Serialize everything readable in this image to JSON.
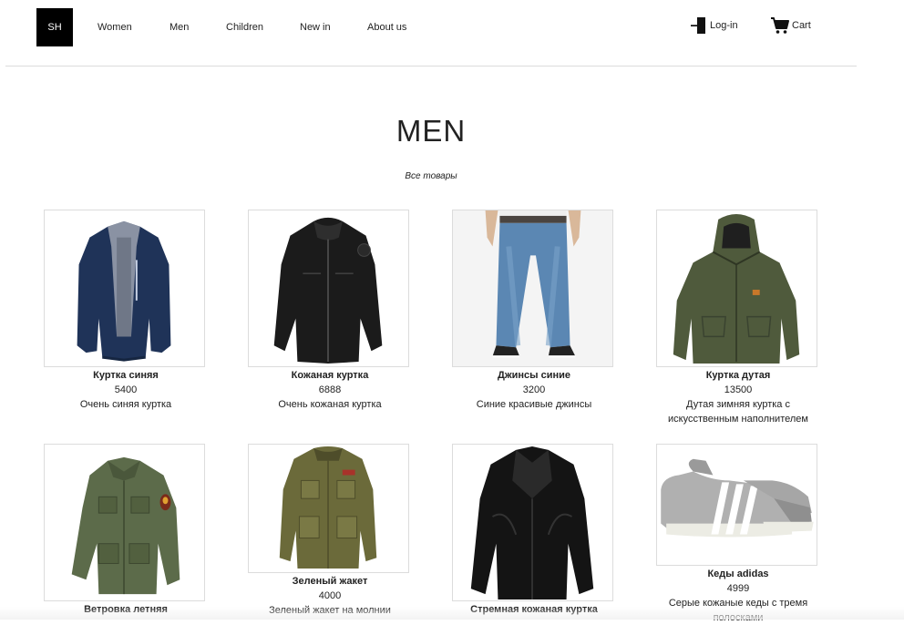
{
  "header": {
    "logo": "SH",
    "nav": [
      "Women",
      "Men",
      "Children",
      "New in",
      "About us"
    ],
    "login_label": "Log-in",
    "cart_label": "Cart"
  },
  "page": {
    "title": "MEN",
    "subtitle": "Все товары"
  },
  "products": [
    {
      "name": "Куртка синяя",
      "price": "5400",
      "description": "Очень синяя куртка",
      "icon": "blue-jacket-image"
    },
    {
      "name": "Кожаная куртка",
      "price": "6888",
      "description": "Очень кожаная куртка",
      "icon": "leather-jacket-image"
    },
    {
      "name": "Джинсы синие",
      "price": "3200",
      "description": "Синие красивые джинсы",
      "icon": "jeans-image"
    },
    {
      "name": "Куртка дутая",
      "price": "13500",
      "description": "Дутая зимняя куртка с искусственным наполнителем",
      "icon": "hooded-jacket-image"
    },
    {
      "name": "Ветровка летняя",
      "price": "",
      "description": "",
      "icon": "windbreaker-image"
    },
    {
      "name": "Зеленый жакет",
      "price": "4000",
      "description": "Зеленый жакет на молнии",
      "icon": "green-jacket-image"
    },
    {
      "name": "Стремная кожаная куртка",
      "price": "",
      "description": "",
      "icon": "black-leather-jacket-image"
    },
    {
      "name": "Кеды adidas",
      "price": "4999",
      "description": "Серые кожаные кеды с тремя полосками",
      "icon": "sneakers-image"
    }
  ],
  "colors": {
    "navy": "#1f3358",
    "black_leather": "#1b1b1b",
    "denim": "#5b87b3",
    "olive": "#4f5a3c",
    "army_green": "#5c6b4a",
    "khaki": "#6b6a3a",
    "sneaker_grey": "#9a9a9a"
  }
}
